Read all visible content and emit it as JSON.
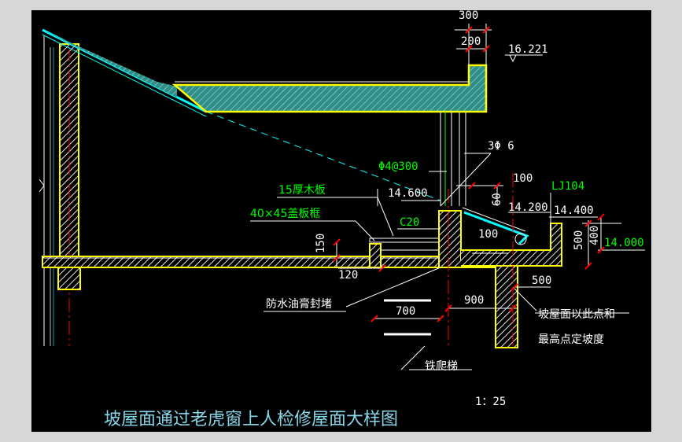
{
  "drawing": {
    "title": "坡屋面通过老虎窗上人检修屋面大样图",
    "scale": "1：25",
    "colors": {
      "background": "#000000",
      "frame": "#d7d7d7",
      "outline": "#ffff00",
      "hatch": "#e6e6e6",
      "slab_fill": "#3a9a93",
      "roof": "#00ffff",
      "dim_white": "#ffffff",
      "label_green": "#00ff00",
      "centerline": "#ff0000",
      "title": "#87d5e8"
    },
    "dimensions": {
      "d300": "300",
      "d200": "200",
      "elev_16221": "16.221",
      "bar_3phi6": "3Φ 6",
      "bar_phi4_300": "Φ4@300",
      "d100_top": "100",
      "lj104": "LJ104",
      "elev_14600": "14.600",
      "d60": "60",
      "elev_14200": "14.200",
      "elev_14400": "14.400",
      "d100_inner": "100",
      "d500_right": "500",
      "d400": "400",
      "elev_14000": "14.000",
      "d150": "150",
      "d120": "120",
      "d500_bottom": "500",
      "d900": "900",
      "d700": "700"
    },
    "labels": {
      "board_15": "15厚木板",
      "frame_40x45": "40×45盖板框",
      "concrete_c20": "C20",
      "waterproof": "防水油膏封堵",
      "slope_note_1": "坡屋面以此点和",
      "slope_note_2": "最高点定坡度",
      "ladder": "铁爬梯"
    }
  }
}
